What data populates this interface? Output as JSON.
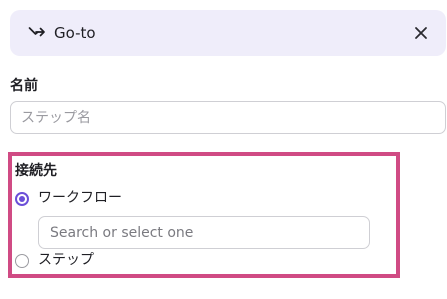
{
  "header": {
    "title": "Go-to",
    "icon": "goto-arrow-icon",
    "close_icon": "close-icon",
    "background": "#efedfa"
  },
  "name_field": {
    "label": "名前",
    "placeholder": "ステップ名",
    "value": ""
  },
  "connection": {
    "label": "接続先",
    "highlight_color": "#d04b84",
    "accent_color": "#6b4fd8",
    "options": [
      {
        "label": "ワークフロー",
        "selected": true
      },
      {
        "label": "ステップ",
        "selected": false
      }
    ],
    "workflow_search": {
      "placeholder": "Search or select one",
      "value": ""
    }
  }
}
